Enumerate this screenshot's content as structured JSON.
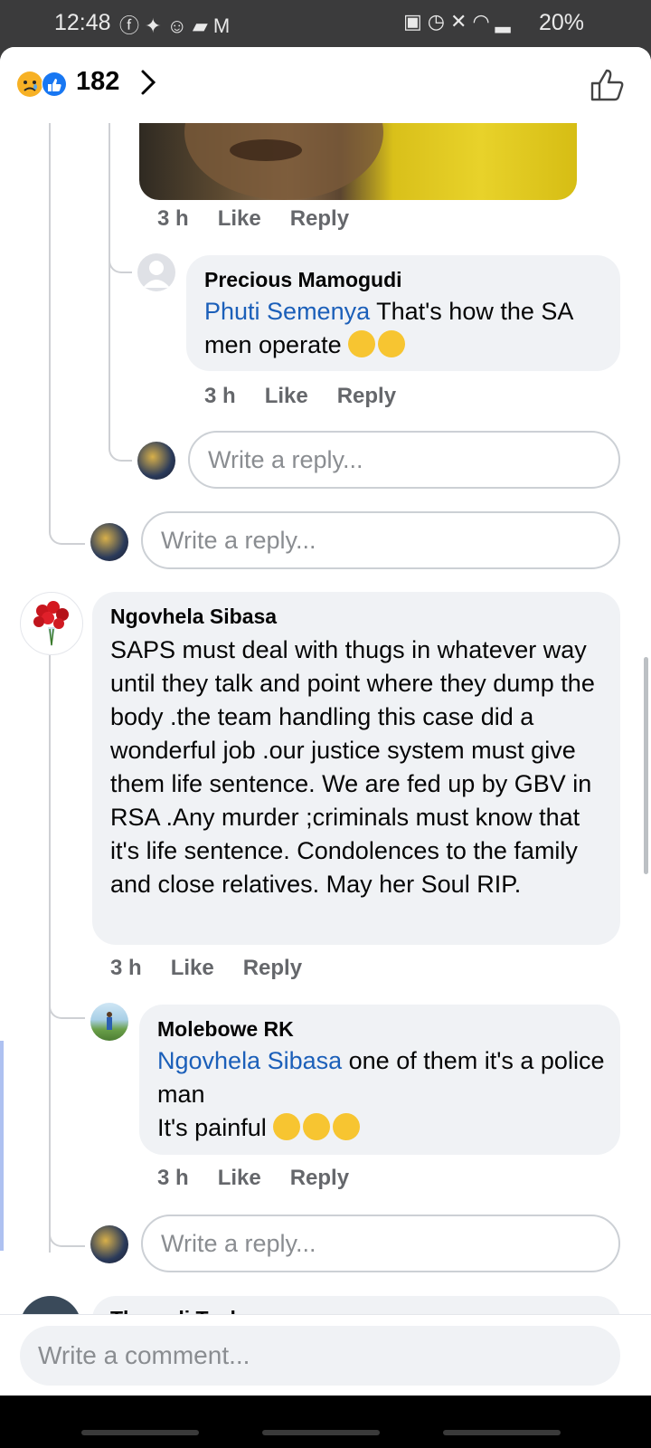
{
  "status_bar": {
    "time": "12:48",
    "left_icons": [
      "facebook-icon",
      "twitter-icon",
      "snapchat-icon",
      "message-icon",
      "gmail-icon"
    ],
    "right_icons": [
      "lock-icon",
      "alarm-icon",
      "mute-icon",
      "wifi-icon",
      "signal-icon"
    ],
    "battery": "20%"
  },
  "header": {
    "reaction_icons": [
      "sad-reaction-icon",
      "like-reaction-icon"
    ],
    "reaction_count": "182"
  },
  "comments": [
    {
      "meta": {
        "time": "3 h",
        "like": "Like",
        "reply": "Reply"
      }
    },
    {
      "author": "Precious Mamogudi",
      "mention": "Phuti Semenya",
      "text": " That's how the SA men operate ",
      "emojis": [
        "zipper-mouth-emoji",
        "zipper-mouth-emoji"
      ],
      "meta": {
        "time": "3 h",
        "like": "Like",
        "reply": "Reply"
      }
    },
    {
      "author": "Ngovhela Sibasa",
      "text": "SAPS  must deal with thugs in whatever way until they talk and point where they dump the body .the team handling this case did a wonderful  job .our justice system  must give them life sentence. We are fed up by GBV  in RSA  .Any murder  ;criminals  must know that it's life sentence. Condolences  to the family and close relatives. May her Soul  RIP.",
      "meta": {
        "time": "3 h",
        "like": "Like",
        "reply": "Reply"
      }
    },
    {
      "author": "Molebowe RK",
      "mention": "Ngovhela Sibasa",
      "text_line1": " one of them it's a police man",
      "text_line2": "It's painful ",
      "emojis": [
        "crying-emoji",
        "crying-emoji",
        "crying-emoji"
      ],
      "meta": {
        "time": "3 h",
        "like": "Like",
        "reply": "Reply"
      }
    },
    {
      "author": "Thanedi Tsakane"
    }
  ],
  "reply_placeholder": "Write a reply...",
  "comment_placeholder": "Write a comment...",
  "colors": {
    "mention": "#1b5fb9",
    "bubble": "#f0f2f5",
    "meta": "#65676b"
  }
}
